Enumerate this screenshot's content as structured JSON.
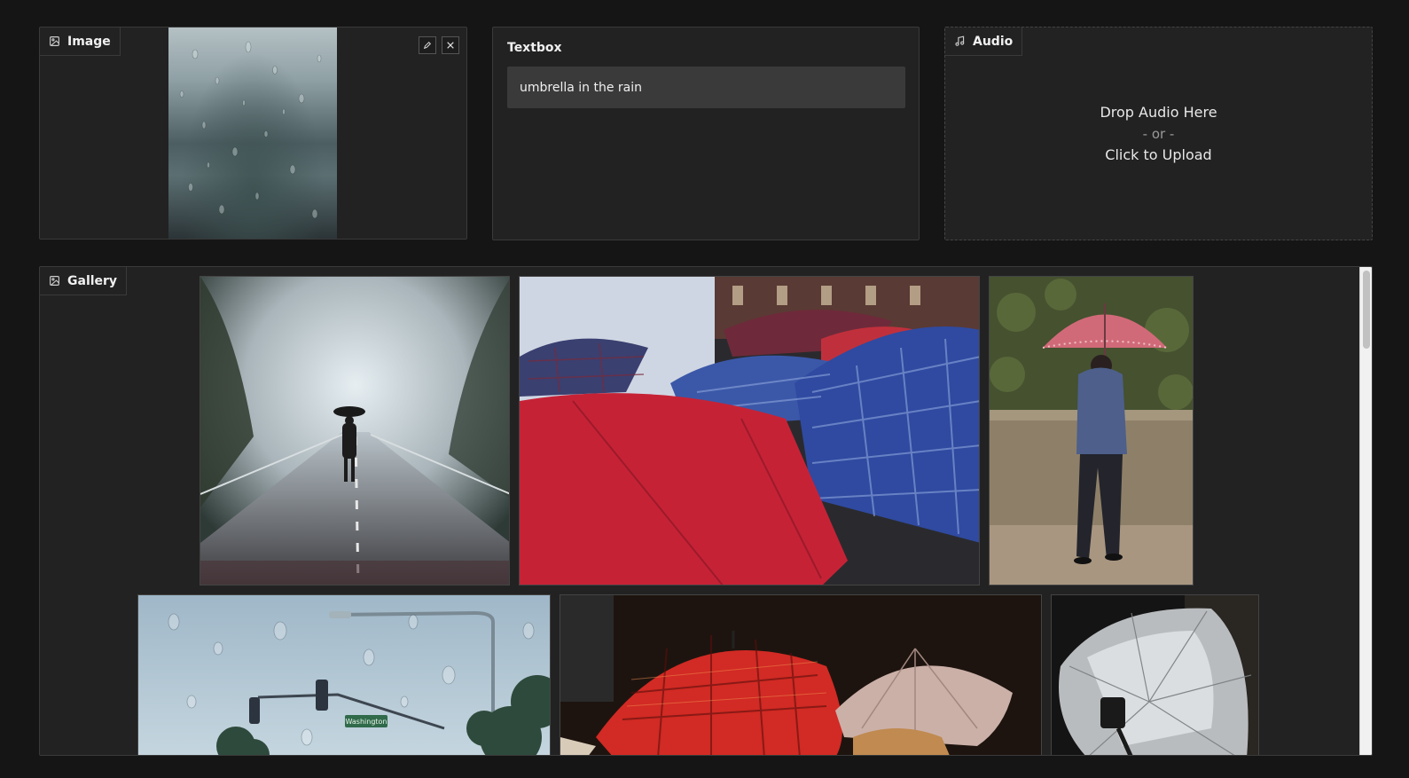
{
  "image_component": {
    "label": "Image",
    "edit_icon": "pencil-icon",
    "clear_icon": "close-icon"
  },
  "textbox": {
    "label": "Textbox",
    "value": "umbrella in the rain"
  },
  "audio": {
    "label": "Audio",
    "drop_text": "Drop Audio Here",
    "or_text": "- or -",
    "click_text": "Click to Upload"
  },
  "gallery": {
    "label": "Gallery",
    "road_sign_text": "Washington"
  },
  "colors": {
    "background": "#151515",
    "panel": "#222222",
    "border": "#3a3a3a",
    "input": "#3a3a3a"
  }
}
